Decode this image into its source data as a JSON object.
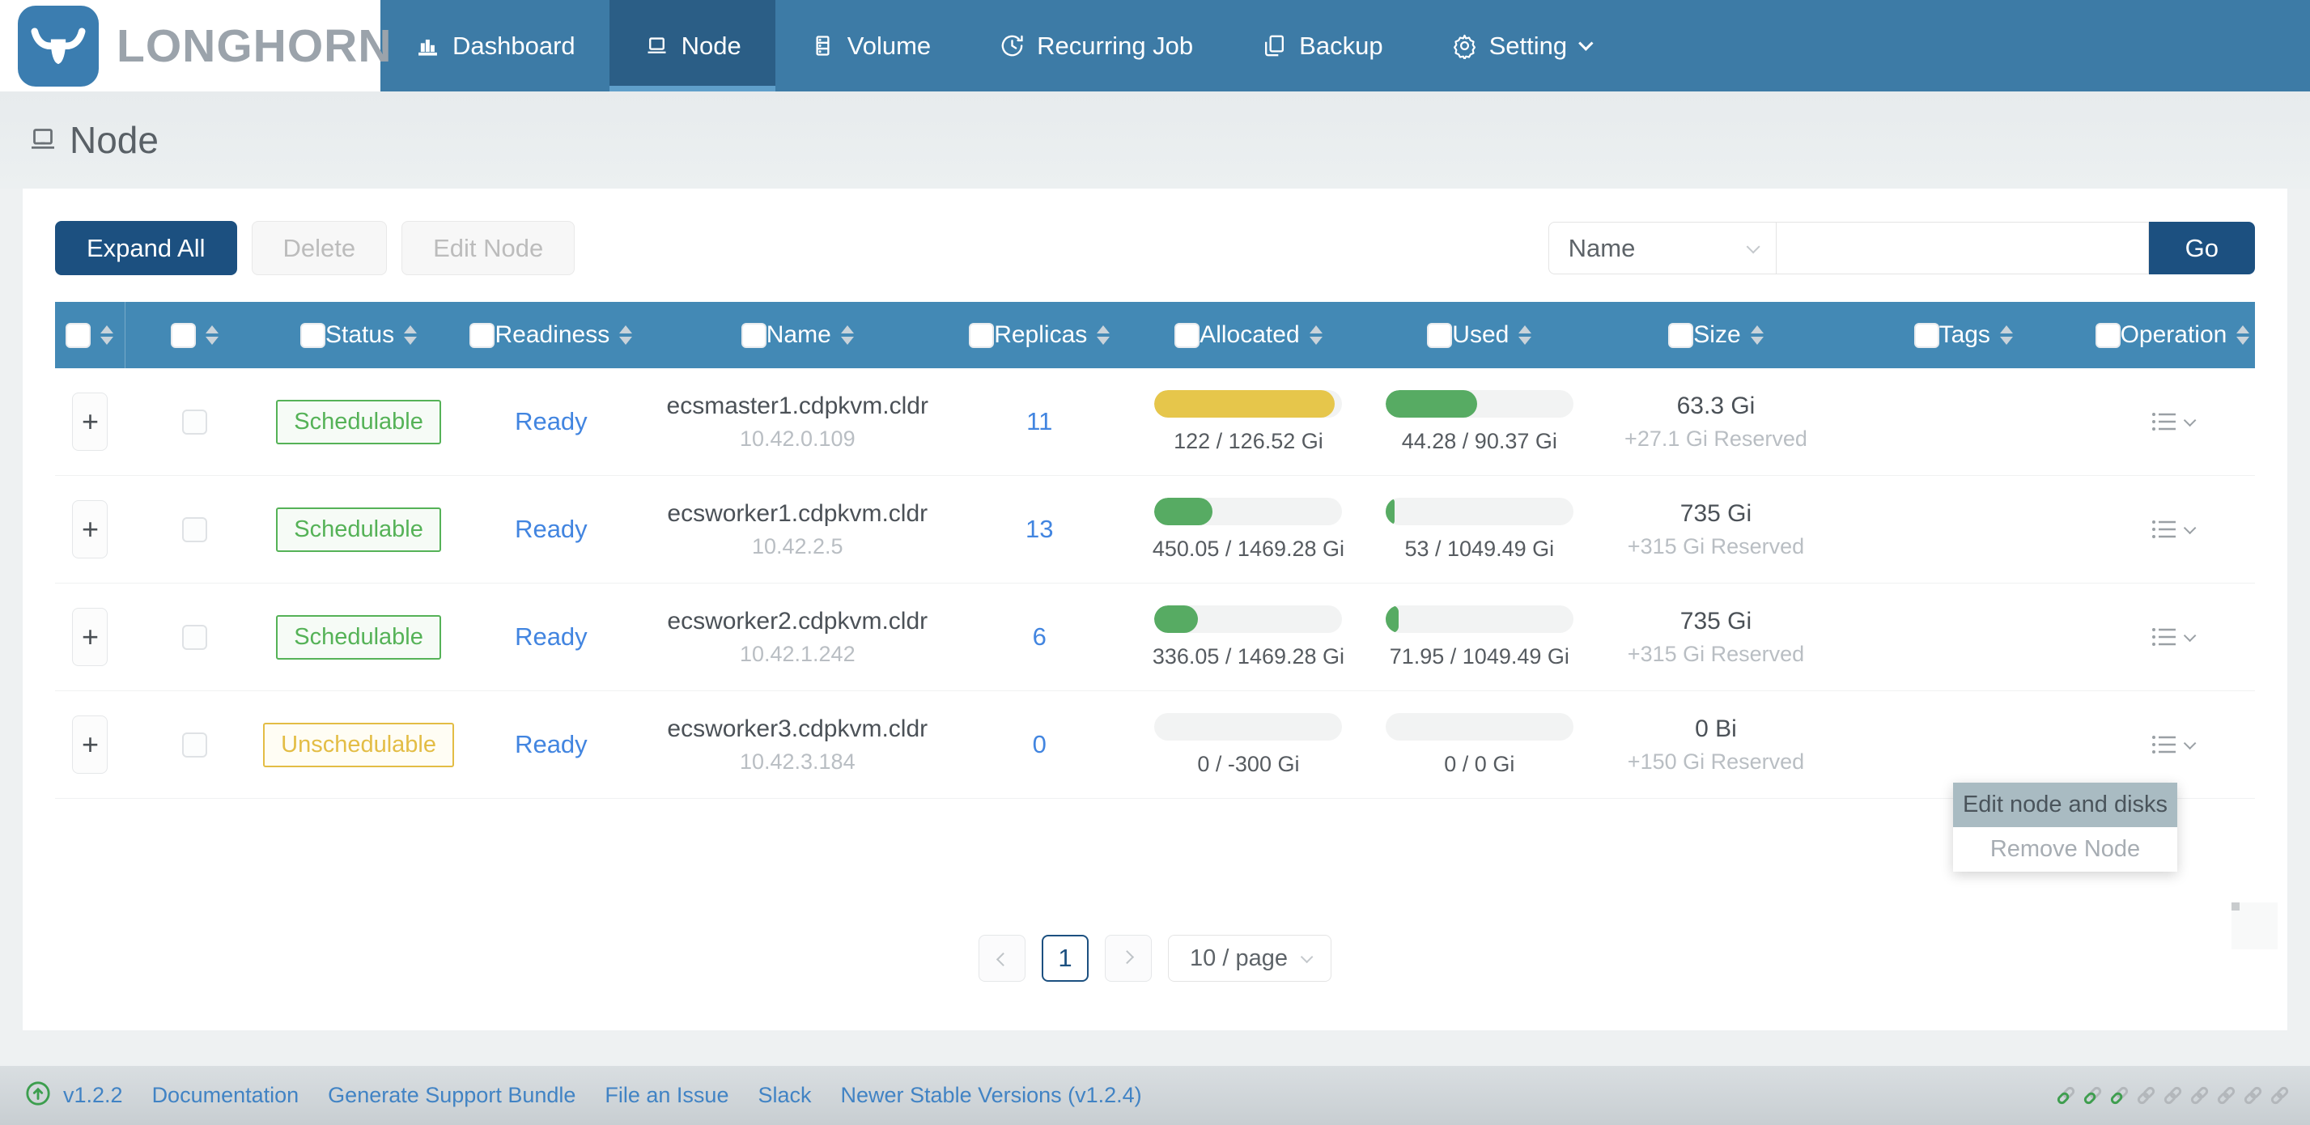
{
  "nav": {
    "logo_text": "LONGHORN",
    "items": [
      {
        "label": "Dashboard",
        "icon": "dashboard",
        "active": false,
        "caret": false
      },
      {
        "label": "Node",
        "icon": "node",
        "active": true,
        "caret": false
      },
      {
        "label": "Volume",
        "icon": "volume",
        "active": false,
        "caret": false
      },
      {
        "label": "Recurring Job",
        "icon": "recurring-job",
        "active": false,
        "caret": false
      },
      {
        "label": "Backup",
        "icon": "backup",
        "active": false,
        "caret": false
      },
      {
        "label": "Setting",
        "icon": "setting",
        "active": false,
        "caret": true
      }
    ]
  },
  "page": {
    "title": "Node"
  },
  "toolbar": {
    "expand_all": "Expand All",
    "delete": "Delete",
    "edit_node": "Edit Node"
  },
  "search": {
    "field": "Name",
    "query": "",
    "go": "Go"
  },
  "table": {
    "columns": [
      {
        "key": "expand",
        "label": "",
        "sort": false
      },
      {
        "key": "check",
        "label": "",
        "sort": false
      },
      {
        "key": "status",
        "label": "Status",
        "sort": true
      },
      {
        "key": "readiness",
        "label": "Readiness",
        "sort": false
      },
      {
        "key": "name",
        "label": "Name",
        "sort": true
      },
      {
        "key": "replicas",
        "label": "Replicas",
        "sort": true
      },
      {
        "key": "allocated",
        "label": "Allocated",
        "sort": true
      },
      {
        "key": "used",
        "label": "Used",
        "sort": true
      },
      {
        "key": "size",
        "label": "Size",
        "sort": true
      },
      {
        "key": "tags",
        "label": "Tags",
        "sort": false
      },
      {
        "key": "operation",
        "label": "Operation",
        "sort": false
      }
    ],
    "rows": [
      {
        "status": "Schedulable",
        "status_type": "ok",
        "readiness": "Ready",
        "name": "ecsmaster1.cdpkvm.cldr",
        "ip": "10.42.0.109",
        "replicas": "11",
        "allocated": {
          "label": "122 / 126.52 Gi",
          "pct": 96,
          "color": "#e6c64b"
        },
        "used": {
          "label": "44.28 / 90.37 Gi",
          "pct": 49,
          "color": "#57ab63"
        },
        "size": "63.3 Gi",
        "reserved": "+27.1 Gi Reserved",
        "tags": ""
      },
      {
        "status": "Schedulable",
        "status_type": "ok",
        "readiness": "Ready",
        "name": "ecsworker1.cdpkvm.cldr",
        "ip": "10.42.2.5",
        "replicas": "13",
        "allocated": {
          "label": "450.05 / 1469.28 Gi",
          "pct": 31,
          "color": "#57ab63"
        },
        "used": {
          "label": "53 / 1049.49 Gi",
          "pct": 5,
          "color": "#57ab63"
        },
        "size": "735 Gi",
        "reserved": "+315 Gi Reserved",
        "tags": ""
      },
      {
        "status": "Schedulable",
        "status_type": "ok",
        "readiness": "Ready",
        "name": "ecsworker2.cdpkvm.cldr",
        "ip": "10.42.1.242",
        "replicas": "6",
        "allocated": {
          "label": "336.05 / 1469.28 Gi",
          "pct": 23,
          "color": "#57ab63"
        },
        "used": {
          "label": "71.95 / 1049.49 Gi",
          "pct": 7,
          "color": "#57ab63"
        },
        "size": "735 Gi",
        "reserved": "+315 Gi Reserved",
        "tags": ""
      },
      {
        "status": "Unschedulable",
        "status_type": "warn",
        "readiness": "Ready",
        "name": "ecsworker3.cdpkvm.cldr",
        "ip": "10.42.3.184",
        "replicas": "0",
        "allocated": {
          "label": "0 / -300 Gi",
          "pct": 0,
          "color": "#57ab63"
        },
        "used": {
          "label": "0 / 0 Gi",
          "pct": 0,
          "color": "#57ab63"
        },
        "size": "0 Bi",
        "reserved": "+150 Gi Reserved",
        "tags": ""
      }
    ]
  },
  "operation_menu": {
    "items": [
      {
        "label": "Edit node and disks",
        "state": "highlighted"
      },
      {
        "label": "Remove Node",
        "state": "disabled"
      }
    ]
  },
  "pagination": {
    "page": "1",
    "page_size": "10 / page"
  },
  "footer": {
    "version": "v1.2.2",
    "links": [
      "Documentation",
      "Generate Support Bundle",
      "File an Issue",
      "Slack",
      "Newer Stable Versions (v1.2.4)"
    ],
    "chain_icons": {
      "green": 3,
      "gray": 6
    }
  },
  "colors": {
    "nav": "#3d7ba6",
    "nav_active": "#2b5e86",
    "nav_active_underline": "#5f9fca",
    "table_header": "#4389b5",
    "primary_button": "#1c5080",
    "status_ok": "#55b257",
    "status_warn": "#e3bd45",
    "link_blue": "#4285e0",
    "footer_link": "#4183c4",
    "bar_yellow": "#e6c64b",
    "bar_green": "#57ab63"
  }
}
